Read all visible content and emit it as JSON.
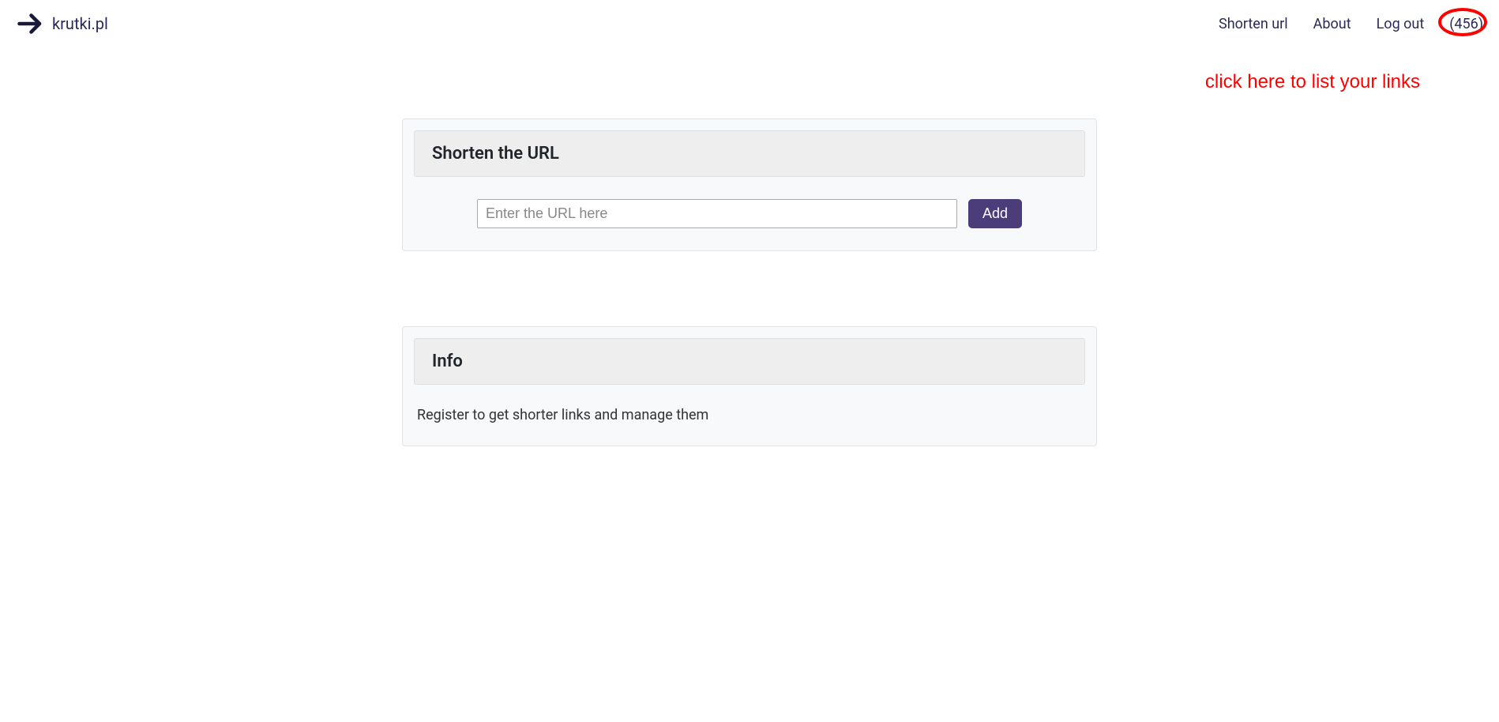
{
  "brand": {
    "name": "krutki.pl"
  },
  "nav": {
    "shorten": "Shorten url",
    "about": "About",
    "logout": "Log out",
    "links_count": "(456)"
  },
  "annotation": {
    "text": "click here to list your links"
  },
  "shorten_card": {
    "title": "Shorten the URL",
    "url_placeholder": "Enter the URL here",
    "add_label": "Add"
  },
  "info_card": {
    "title": "Info",
    "body": "Register to get shorter links and manage them"
  }
}
